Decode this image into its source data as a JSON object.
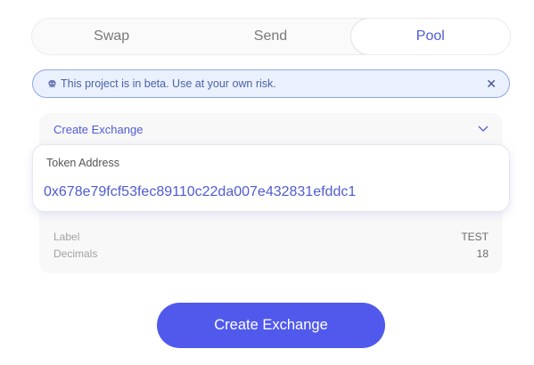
{
  "tabs": [
    {
      "label": "Swap",
      "active": false
    },
    {
      "label": "Send",
      "active": false
    },
    {
      "label": "Pool",
      "active": true
    }
  ],
  "beta_banner": {
    "icon": "skull-icon",
    "text": "This project is in beta. Use at your own risk.",
    "close": "✕"
  },
  "panel": {
    "title": "Create Exchange",
    "chevron": "chevron-down-icon"
  },
  "token": {
    "label": "Token Address",
    "value": "0x678e79fcf53fec89110c22da007e432831efddc1"
  },
  "info": [
    {
      "key": "Label",
      "value": "TEST"
    },
    {
      "key": "Decimals",
      "value": "18"
    }
  ],
  "action_button": "Create Exchange",
  "colors": {
    "accent": "#5059ec",
    "link": "#4f5bd5",
    "banner_bg": "#eaf1fd",
    "banner_border": "#8aa8e8"
  }
}
